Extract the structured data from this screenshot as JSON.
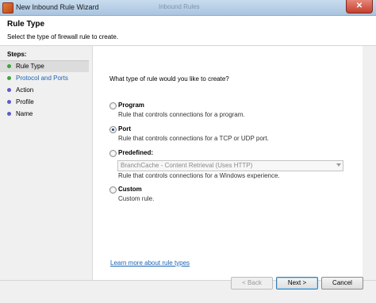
{
  "window": {
    "title": "New Inbound Rule Wizard",
    "background_title": "Inbound Rules",
    "close_glyph": "✕"
  },
  "header": {
    "title": "Rule Type",
    "subtitle": "Select the type of firewall rule to create."
  },
  "steps": {
    "label": "Steps:",
    "items": [
      {
        "label": "Rule Type",
        "color": "#3aa63a",
        "state": "current"
      },
      {
        "label": "Protocol and Ports",
        "color": "#3aa63a",
        "state": "link"
      },
      {
        "label": "Action",
        "color": "#5b5bc8",
        "state": "normal"
      },
      {
        "label": "Profile",
        "color": "#5b5bc8",
        "state": "normal"
      },
      {
        "label": "Name",
        "color": "#5b5bc8",
        "state": "normal"
      }
    ]
  },
  "content": {
    "question": "What type of rule would you like to create?",
    "options": [
      {
        "title": "Program",
        "description": "Rule that controls connections for a program.",
        "selected": false
      },
      {
        "title": "Port",
        "description": "Rule that controls connections for a TCP or UDP port.",
        "selected": true
      },
      {
        "title": "Predefined:",
        "description": "Rule that controls connections for a Windows experience.",
        "selected": false
      },
      {
        "title": "Custom",
        "description": "Custom rule.",
        "selected": false
      }
    ],
    "predefined_select_value": "BranchCache - Content Retrieval (Uses HTTP)",
    "learn_more_link": "Learn more about rule types"
  },
  "buttons": {
    "back": "< Back",
    "next": "Next >",
    "cancel": "Cancel"
  }
}
